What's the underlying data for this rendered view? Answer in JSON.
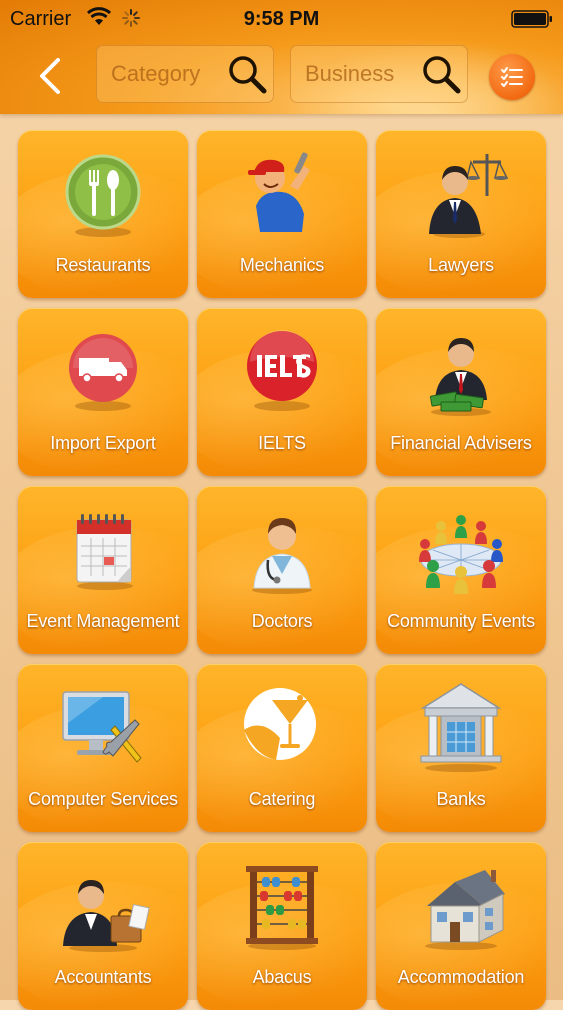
{
  "status_bar": {
    "carrier": "Carrier",
    "time": "9:58 PM"
  },
  "nav": {
    "category_placeholder": "Category",
    "business_placeholder": "Business"
  },
  "colors": {
    "accent": "#f59a1a",
    "tile": "#fd9f12",
    "menu_button": "#f26a12"
  },
  "categories": [
    {
      "label": "Restaurants",
      "icon": "restaurant-plate-icon"
    },
    {
      "label": "Mechanics",
      "icon": "mechanic-icon"
    },
    {
      "label": "Lawyers",
      "icon": "lawyer-scales-icon"
    },
    {
      "label": "Import Export",
      "icon": "delivery-truck-icon"
    },
    {
      "label": "IELTS",
      "icon": "ielts-badge-icon"
    },
    {
      "label": "Financial Advisers",
      "icon": "financial-adviser-icon"
    },
    {
      "label": "Event Management",
      "icon": "calendar-icon"
    },
    {
      "label": "Doctors",
      "icon": "doctor-icon"
    },
    {
      "label": "Community Events",
      "icon": "community-people-icon"
    },
    {
      "label": "Computer Services",
      "icon": "computer-tools-icon"
    },
    {
      "label": "Catering",
      "icon": "cocktail-glass-icon"
    },
    {
      "label": "Banks",
      "icon": "bank-building-icon"
    },
    {
      "label": "Accountants",
      "icon": "accountant-icon"
    },
    {
      "label": "Abacus",
      "icon": "abacus-icon"
    },
    {
      "label": "Accommodation",
      "icon": "house-icon"
    }
  ]
}
